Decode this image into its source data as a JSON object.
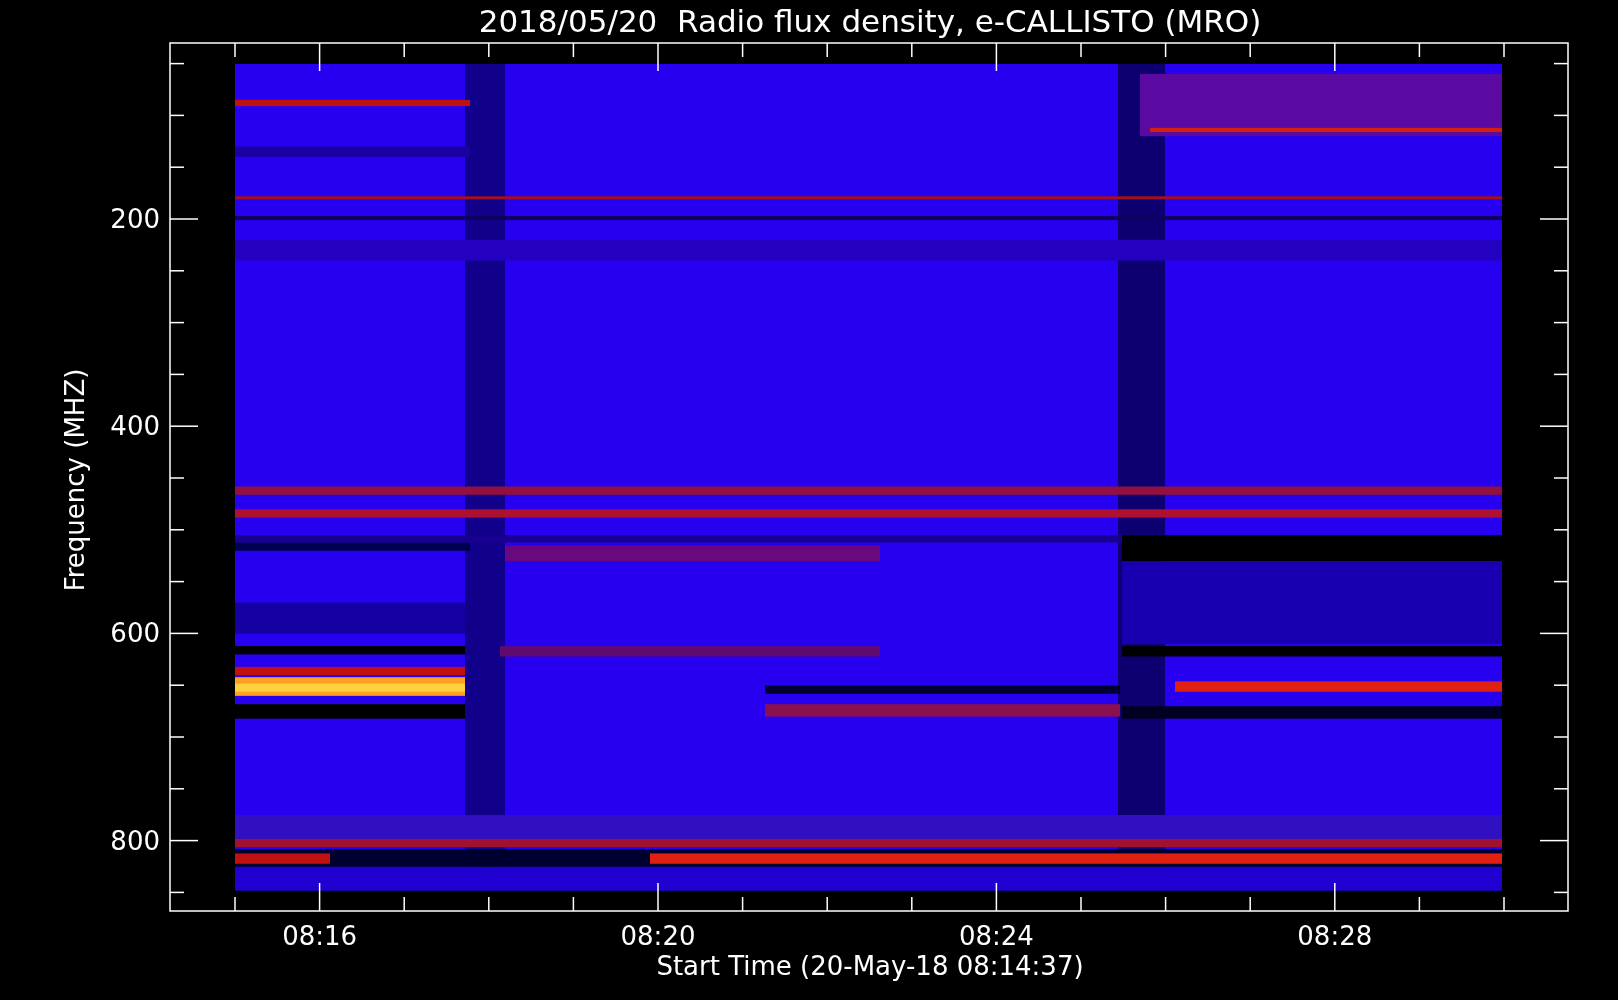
{
  "title": "2018/05/20  Radio flux density, e-CALLISTO (MRO)",
  "plot": {
    "xlabel": "Start Time (20-May-18 08:14:37)",
    "ylabel": "Frequency (MHZ)",
    "xticks": [
      "08:16",
      "08:20",
      "08:24",
      "08:28"
    ],
    "yticks": [
      "200",
      "400",
      "600",
      "800"
    ]
  }
}
